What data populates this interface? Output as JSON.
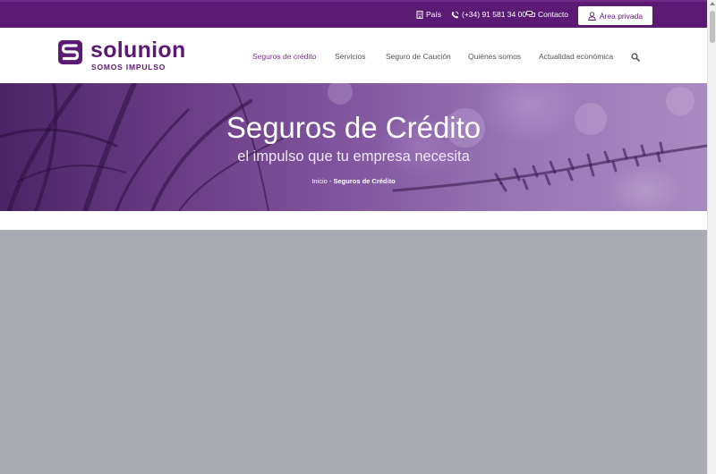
{
  "topbar": {
    "country_label": "País",
    "phone": "(+34) 91 581 34 00",
    "contact_label": "Contacto",
    "area_label": "Área privada"
  },
  "logo": {
    "name": "solunion",
    "tagline": "SOMOS IMPULSO"
  },
  "nav": {
    "items": [
      {
        "label": "Seguros de crédito",
        "active": true
      },
      {
        "label": "Servicios",
        "active": false
      },
      {
        "label": "Seguro de Caución",
        "active": false
      },
      {
        "label": "Quiénes somos",
        "active": false
      },
      {
        "label": "Actualidad económica",
        "active": false
      }
    ],
    "search_icon": "search-icon"
  },
  "hero": {
    "title": "Seguros de Crédito",
    "subtitle": "el impulso que tu empresa necesita",
    "breadcrumb": {
      "home": "Inicio",
      "separator": " - ",
      "current": "Seguros de Crédito"
    }
  },
  "colors": {
    "brand": "#5b1a74",
    "nav_active": "#7a2f95",
    "nav_text": "#555555",
    "overlay": "#abacb1"
  }
}
